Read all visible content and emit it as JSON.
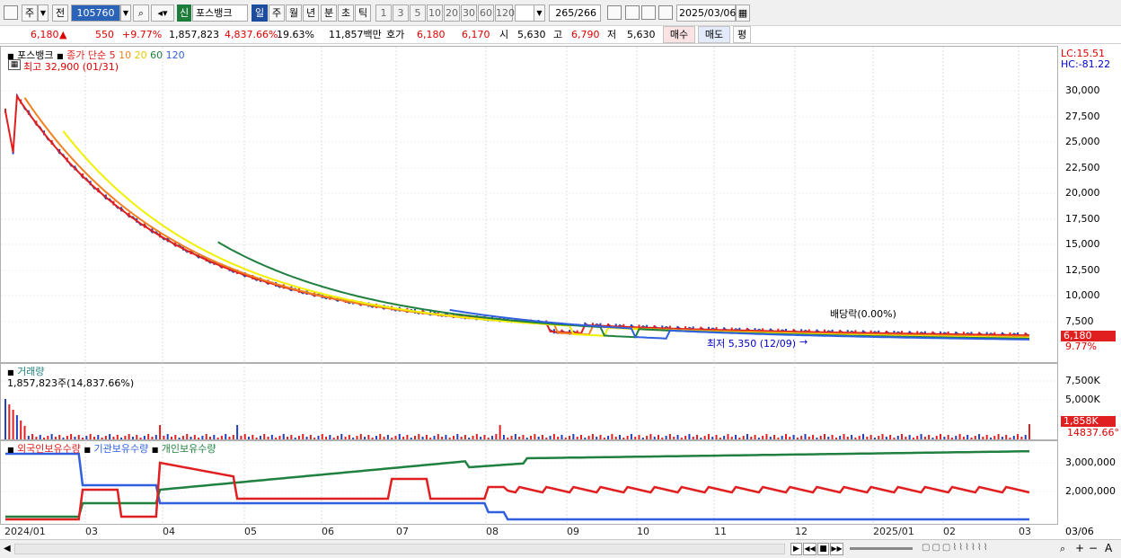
{
  "toolbar": {
    "stock_code": "105760",
    "type_label": "주",
    "full_label": "전",
    "credit_badge": "신",
    "stock_name": "포스뱅크",
    "periods": [
      "일",
      "주",
      "월",
      "년",
      "분",
      "초",
      "틱"
    ],
    "selected_period": "일",
    "intervals": [
      "1",
      "3",
      "5",
      "10",
      "20",
      "30",
      "60",
      "120"
    ],
    "count": "265",
    "count_total": "/266",
    "date": "2025/03/06"
  },
  "quote": {
    "price": "6,180",
    "change_arrow": "▲",
    "change": "550",
    "change_pct": "+9.77%",
    "volume": "1,857,823",
    "volume_ratio": "4,837.66%",
    "turnover": "19.63%",
    "amount": "11,857백만",
    "hoga_label": "호가",
    "ask": "6,180",
    "bid": "6,170",
    "open_label": "시",
    "open": "5,630",
    "high_label": "고",
    "high": "6,790",
    "low_label": "저",
    "low": "5,630",
    "buy_label": "매수",
    "sell_label": "매도",
    "avg_label": "평"
  },
  "price_panel": {
    "name": "포스뱅크",
    "ma_label": "종가 단순",
    "ma_periods": [
      "5",
      "10",
      "20",
      "60",
      "120"
    ],
    "ma_colors": [
      "#e02020",
      "#f08020",
      "#e8e800",
      "#208040",
      "#3060e0"
    ],
    "max_label": "최고 32,900 (01/31)",
    "min_label": "최저 5,350 (12/09)",
    "min_arrow": "→",
    "dividend_label": "배당락(0.00%)",
    "lc_label": "LC:15.51",
    "hc_label": "HC:-81.22",
    "last_price_badge": "6,180",
    "last_pct": "9.77%",
    "y_ticks": [
      "30,000",
      "27,500",
      "25,000",
      "22,500",
      "20,000",
      "17,500",
      "15,000",
      "12,500",
      "10,000",
      "7,500"
    ]
  },
  "volume_panel": {
    "title": "거래량",
    "value_label": "1,857,823주(14,837.66%)",
    "y_ticks": [
      "7,500K",
      "5,000K"
    ],
    "last_badge": "1,858K",
    "last_pct": "14837.66°"
  },
  "holders_panel": {
    "series_labels": [
      "외국인보유수량",
      "기관보유수량",
      "개인보유수량"
    ],
    "y_ticks": [
      "3,000,000",
      "2,000,000"
    ]
  },
  "x_ticks": [
    "2024/01",
    "03",
    "04",
    "05",
    "06",
    "07",
    "08",
    "09",
    "10",
    "11",
    "12",
    "2025/01",
    "02",
    "03"
  ],
  "x_axis_right": "03/06",
  "bottom_controls": [
    "▶",
    "◀◀",
    "■",
    "▶▶",
    "+",
    "−",
    "A"
  ]
}
